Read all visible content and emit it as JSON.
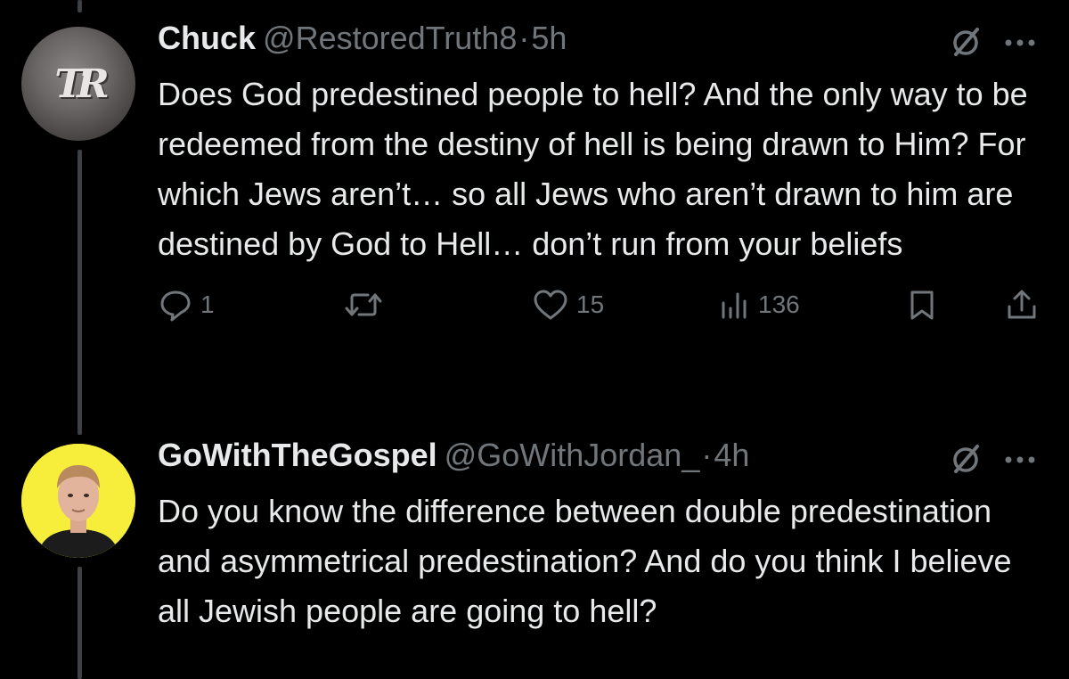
{
  "tweets": [
    {
      "display_name": "Chuck",
      "handle": "@RestoredTruth8",
      "separator": "·",
      "time": "5h",
      "avatar_text": "TR",
      "text": "Does God predestined people to hell? And the only way to be redeemed from the destiny of hell is being drawn to Him? For which Jews aren’t… so all Jews who aren’t drawn to him are destined by God to Hell… don’t run from your beliefs",
      "actions": {
        "replies": "1",
        "reposts": "",
        "likes": "15",
        "views": "136"
      }
    },
    {
      "display_name": "GoWithTheGospel",
      "handle": "@GoWithJordan_",
      "separator": "·",
      "time": "4h",
      "text": "Do you know the difference between double predestination and asymmetrical predestination? And do you think I believe all Jewish people are going to hell?"
    }
  ],
  "icons": {
    "grok": "grok-icon",
    "more": "more-icon",
    "reply": "reply-icon",
    "repost": "repost-icon",
    "like": "heart-icon",
    "views": "views-icon",
    "bookmark": "bookmark-icon",
    "share": "share-icon"
  },
  "colors": {
    "background": "#000000",
    "primary_text": "#e7e9ea",
    "secondary_text": "#71767b",
    "thread_line": "#3e4144",
    "gospel_avatar_bg": "#f6ee3a"
  }
}
